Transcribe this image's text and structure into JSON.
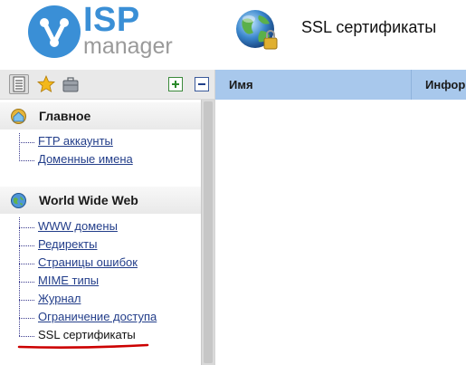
{
  "header": {
    "logo_primary": "ISP",
    "logo_secondary": "manager",
    "page_title": "SSL сертификаты"
  },
  "sidebar": {
    "sections": [
      {
        "label": "Главное",
        "items": [
          "FTP аккаунты",
          "Доменные имена"
        ]
      },
      {
        "label": "World Wide Web",
        "items": [
          "WWW домены",
          "Редиректы",
          "Страницы ошибок",
          "MIME типы",
          "Журнал",
          "Ограничение доступа",
          "SSL сертификаты"
        ]
      }
    ]
  },
  "table": {
    "columns": [
      "Имя",
      "Информация"
    ]
  },
  "colors": {
    "accent_blue": "#3a8fd6",
    "list_header": "#a8c8ec",
    "link": "#233e8a",
    "highlight_underline": "#cc0000"
  }
}
